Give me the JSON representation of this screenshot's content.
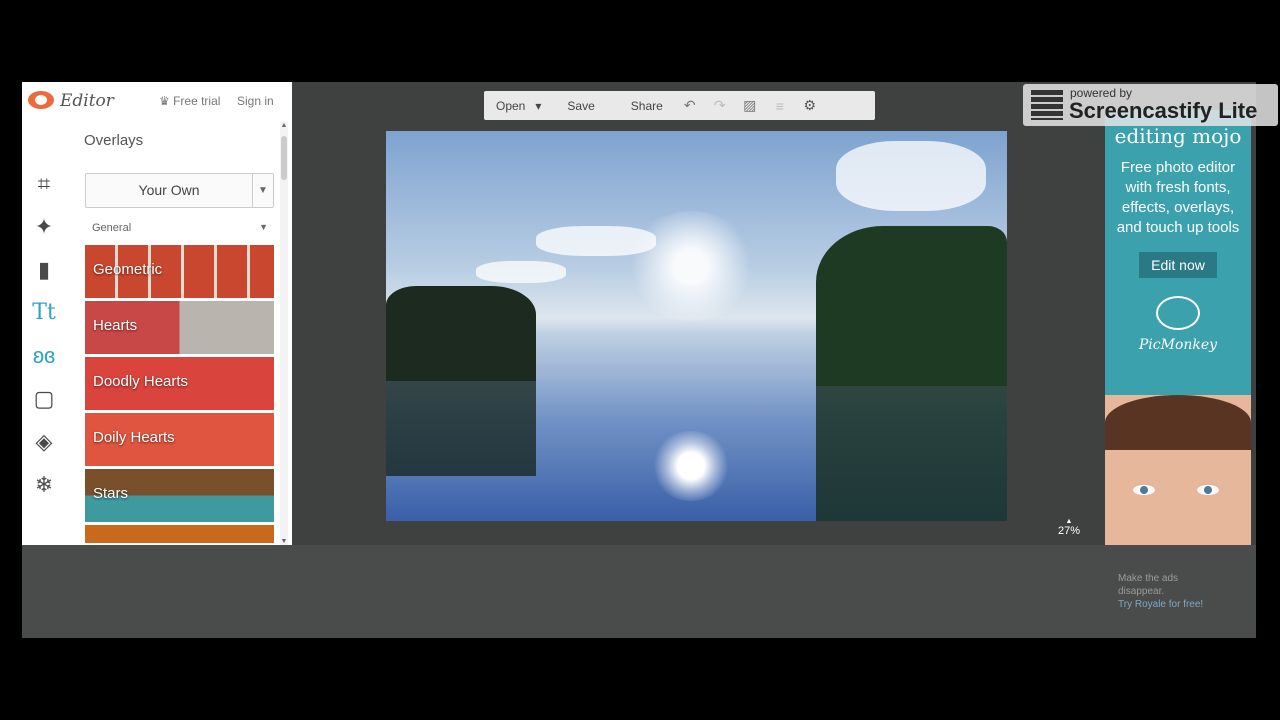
{
  "app": {
    "name": "Editor",
    "free_trial": "Free trial",
    "sign_in": "Sign in",
    "logo_icon": "monkey-logo-icon"
  },
  "tools": [
    {
      "name": "crop-icon",
      "glyph": "⌗"
    },
    {
      "name": "magic-wand-icon",
      "glyph": "✦"
    },
    {
      "name": "brush-icon",
      "glyph": "▮"
    },
    {
      "name": "text-icon",
      "glyph": "Tt"
    },
    {
      "name": "butterfly-icon",
      "glyph": "ʚɞ"
    },
    {
      "name": "frame-icon",
      "glyph": "▢"
    },
    {
      "name": "texture-icon",
      "glyph": "◈"
    },
    {
      "name": "snowflake-icon",
      "glyph": "❄"
    }
  ],
  "panel": {
    "title": "Overlays",
    "your_own": "Your Own",
    "category": "General",
    "tiles": [
      "Geometric",
      "Hearts",
      "Doodly Hearts",
      "Doily Hearts",
      "Stars"
    ]
  },
  "toolbar": {
    "open": "Open",
    "save": "Save",
    "share": "Share",
    "open_caret": "▾"
  },
  "zoom": {
    "value": "27%"
  },
  "ad": {
    "heading": "editing mojo",
    "body": "Free photo editor with fresh fonts, effects, overlays, and touch up tools",
    "button": "Edit now",
    "brand": "PicMonkey",
    "note1": "Make the ads disappear.",
    "note2": "Try Royale for free!"
  },
  "badge": {
    "powered": "powered by",
    "name": "Screencastify Lite"
  },
  "colors": {
    "accent": "#2ea3c9",
    "ad_bg": "#3aa1ad",
    "logo": "#ef6a3a"
  }
}
